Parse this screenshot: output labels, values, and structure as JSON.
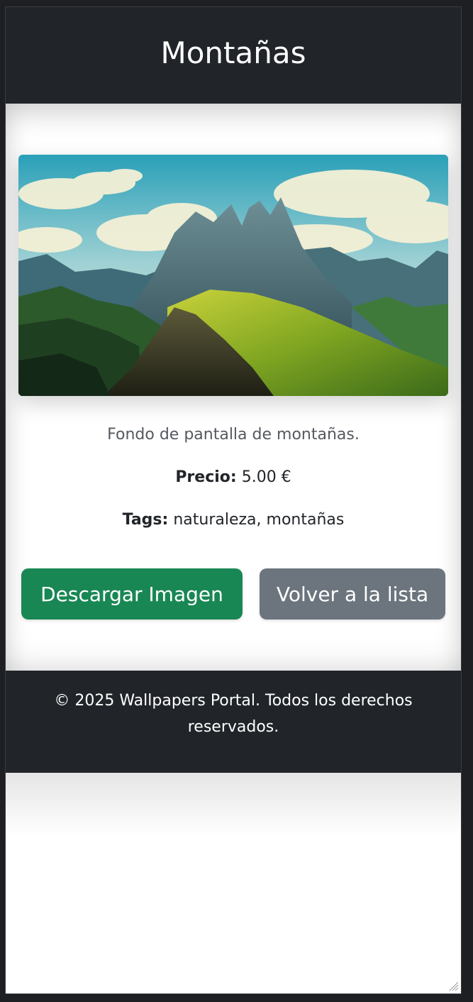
{
  "header": {
    "title": "Montañas"
  },
  "wallpaper": {
    "description": "Fondo de pantalla de montañas.",
    "price_label": "Precio:",
    "price_value": "5.00 €",
    "tags_label": "Tags:",
    "tags_value": "naturaleza, montañas"
  },
  "actions": {
    "download_label": "Descargar Imagen",
    "back_label": "Volver a la lista",
    "download_color": "#198754",
    "back_color": "#6c757d"
  },
  "footer": {
    "text": "© 2025 Wallpapers Portal. Todos los derechos reservados."
  },
  "icons": {
    "resize": "resize-grip-icon"
  }
}
